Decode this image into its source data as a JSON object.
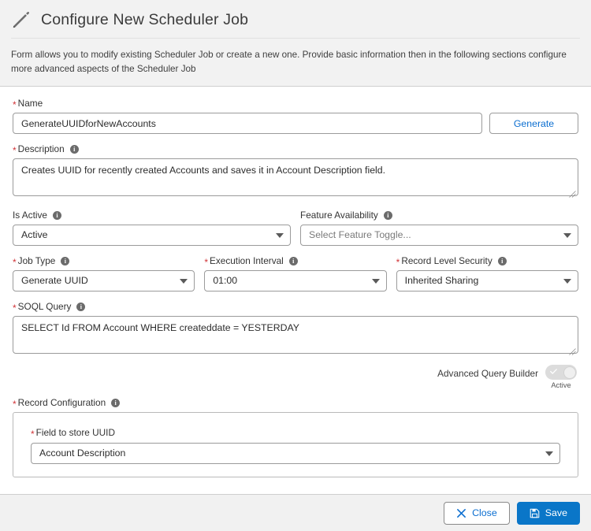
{
  "header": {
    "icon": "pencil-icon",
    "title": "Configure New Scheduler Job",
    "description": "Form allows you to modify existing Scheduler Job or create a new one. Provide basic information then in the following sections configure more advanced aspects of the Scheduler Job"
  },
  "form": {
    "name": {
      "label": "Name",
      "required": true,
      "value": "GenerateUUIDforNewAccounts",
      "placeholder": "",
      "generate_button": "Generate"
    },
    "description": {
      "label": "Description",
      "required": true,
      "info": true,
      "value": "Creates UUID for recently created Accounts and saves it in Account Description field."
    },
    "is_active": {
      "label": "Is Active",
      "required": false,
      "info": true,
      "value": "Active"
    },
    "feature_availability": {
      "label": "Feature Availability",
      "required": false,
      "info": true,
      "value": "",
      "placeholder": "Select Feature Toggle..."
    },
    "job_type": {
      "label": "Job Type",
      "required": true,
      "info": true,
      "value": "Generate UUID"
    },
    "execution_interval": {
      "label": "Execution Interval",
      "required": true,
      "info": true,
      "value": "01:00"
    },
    "record_level_security": {
      "label": "Record Level Security",
      "required": true,
      "info": true,
      "value": "Inherited Sharing"
    },
    "soql_query": {
      "label": "SOQL Query",
      "required": true,
      "info": true,
      "value": "SELECT Id FROM Account WHERE createddate = YESTERDAY"
    },
    "advanced_query_builder": {
      "label": "Advanced Query Builder",
      "state_label": "Active",
      "checked": true,
      "disabled": true
    },
    "record_configuration": {
      "label": "Record Configuration",
      "required": true,
      "info": true,
      "field_to_store_uuid": {
        "label": "Field to store UUID",
        "required": true,
        "value": "Account Description"
      }
    }
  },
  "footer": {
    "close_label": "Close",
    "save_label": "Save"
  },
  "colors": {
    "accent": "#0a76c8",
    "link": "#0b6ed0",
    "required": "#d13438",
    "header_bg": "#f2f2f2",
    "footer_bg": "#f1f1f1",
    "border": "#9b9b9b"
  }
}
